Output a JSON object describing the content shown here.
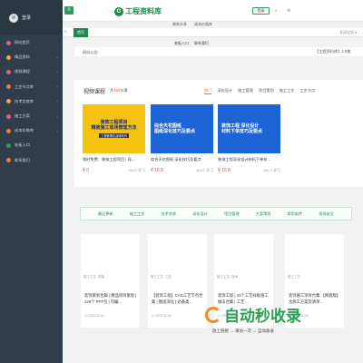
{
  "sidebar": {
    "login_label": "登录",
    "items": [
      {
        "label": "网站首页",
        "icon": "home-icon",
        "color": "#e85a8a",
        "arrow": false
      },
      {
        "label": "精品资料",
        "icon": "diamond-icon",
        "color": "#f0a43a",
        "arrow": true
      },
      {
        "label": "视频课程",
        "icon": "video-icon",
        "color": "#e85a8a",
        "arrow": true
      },
      {
        "label": "工艺节点库",
        "icon": "node-icon",
        "color": "#f07a3a",
        "arrow": true
      },
      {
        "label": "技术交底库",
        "icon": "book-icon",
        "color": "#f0a43a",
        "arrow": true
      },
      {
        "label": "施工方案",
        "icon": "doc-icon",
        "color": "#e85a8a",
        "arrow": true
      },
      {
        "label": "成本价格库",
        "icon": "price-icon",
        "color": "#f07a3a",
        "arrow": true
      },
      {
        "label": "老板入口",
        "icon": "boss-icon",
        "color": "#2e9b5b",
        "arrow": false
      },
      {
        "label": "联系我们",
        "icon": "contact-icon",
        "color": "#f07a3a",
        "arrow": false
      }
    ]
  },
  "topbar": {
    "menu_icon": "≡",
    "logo_mark": "G",
    "logo_text": "工程资料库",
    "search_label": "登录",
    "sub_nav": [
      "装饰头条",
      "成本价格库"
    ]
  },
  "tabbar": {
    "prev": "«",
    "home": "首页",
    "close": "关闭全部 ▾"
  },
  "quicklinks": [
    "老板入口",
    "联系我们"
  ],
  "notice": {
    "label": "网站公告:",
    "link": "【工程资料库】2.0使:"
  },
  "courses": {
    "title": "视频课程",
    "count_prefix": "共",
    "count": "152",
    "count_suffix": "节课",
    "tabs": [
      "热门",
      "深化设计",
      "施工管理",
      "项目策划",
      "施工工艺",
      "工艺节点"
    ],
    "active_tab": 0,
    "cards": [
      {
        "thumb_title": "装饰工程项目\n精装施工现场管理方法",
        "thumb_sub": "工程管理实战课系列",
        "name": "限时免费：装饰工程项目 | 现...",
        "price": "¥ 0",
        "learners": "254人学习",
        "color": "#f5c20f"
      },
      {
        "thumb_title": "综合天花图纸\n图纸深化技巧及要点",
        "thumb_sub": "",
        "name": "综合天花图纸 深化技巧及要点",
        "price": "¥ 16.8",
        "learners": "819人学习",
        "color": "#1d64d6"
      },
      {
        "thumb_title": "装饰工程 深化设计\n材料下单技巧及要点",
        "thumb_sub": "",
        "name": "装饰工程深化设计材料下单技...",
        "price": "¥ 16.8",
        "learners": "681人学习",
        "color": "#1d64d6"
      }
    ]
  },
  "doc_tabs": [
    "最近更新",
    "施工工艺",
    "技术交底",
    "深化设计",
    "项目管理",
    "方案策划",
    "常用软件",
    "现场安全"
  ],
  "docs": [
    {
      "tags": [
        "施工工艺",
        "质量"
      ],
      "name": "装饰策划合辑 | 精品项目策划 | 129个 PPT包 | 可编...",
      "date": "2023-11-04"
    },
    {
      "tags": [
        "施工工艺",
        "工艺"
      ],
      "name": "【装饰工程】CAD工艺节点合集 | 图纸深化 | 必备类...",
      "date": "2023-11-04"
    },
    {
      "tags": [
        "施工工艺",
        "技术"
      ],
      "name": "装饰工程 | 43个工艺样板施工做法合集 | 工艺...",
      "date": "2023-11-04"
    },
    {
      "tags": [
        "施工工艺"
      ],
      "name": "装饰施工项目合集 【网盘版】含施工方案及清单...",
      "date": "2023-11-04"
    }
  ],
  "watermark": {
    "text": "自动秒收录",
    "slogan": "放上链接 → 来访一次 → 自动收录"
  }
}
